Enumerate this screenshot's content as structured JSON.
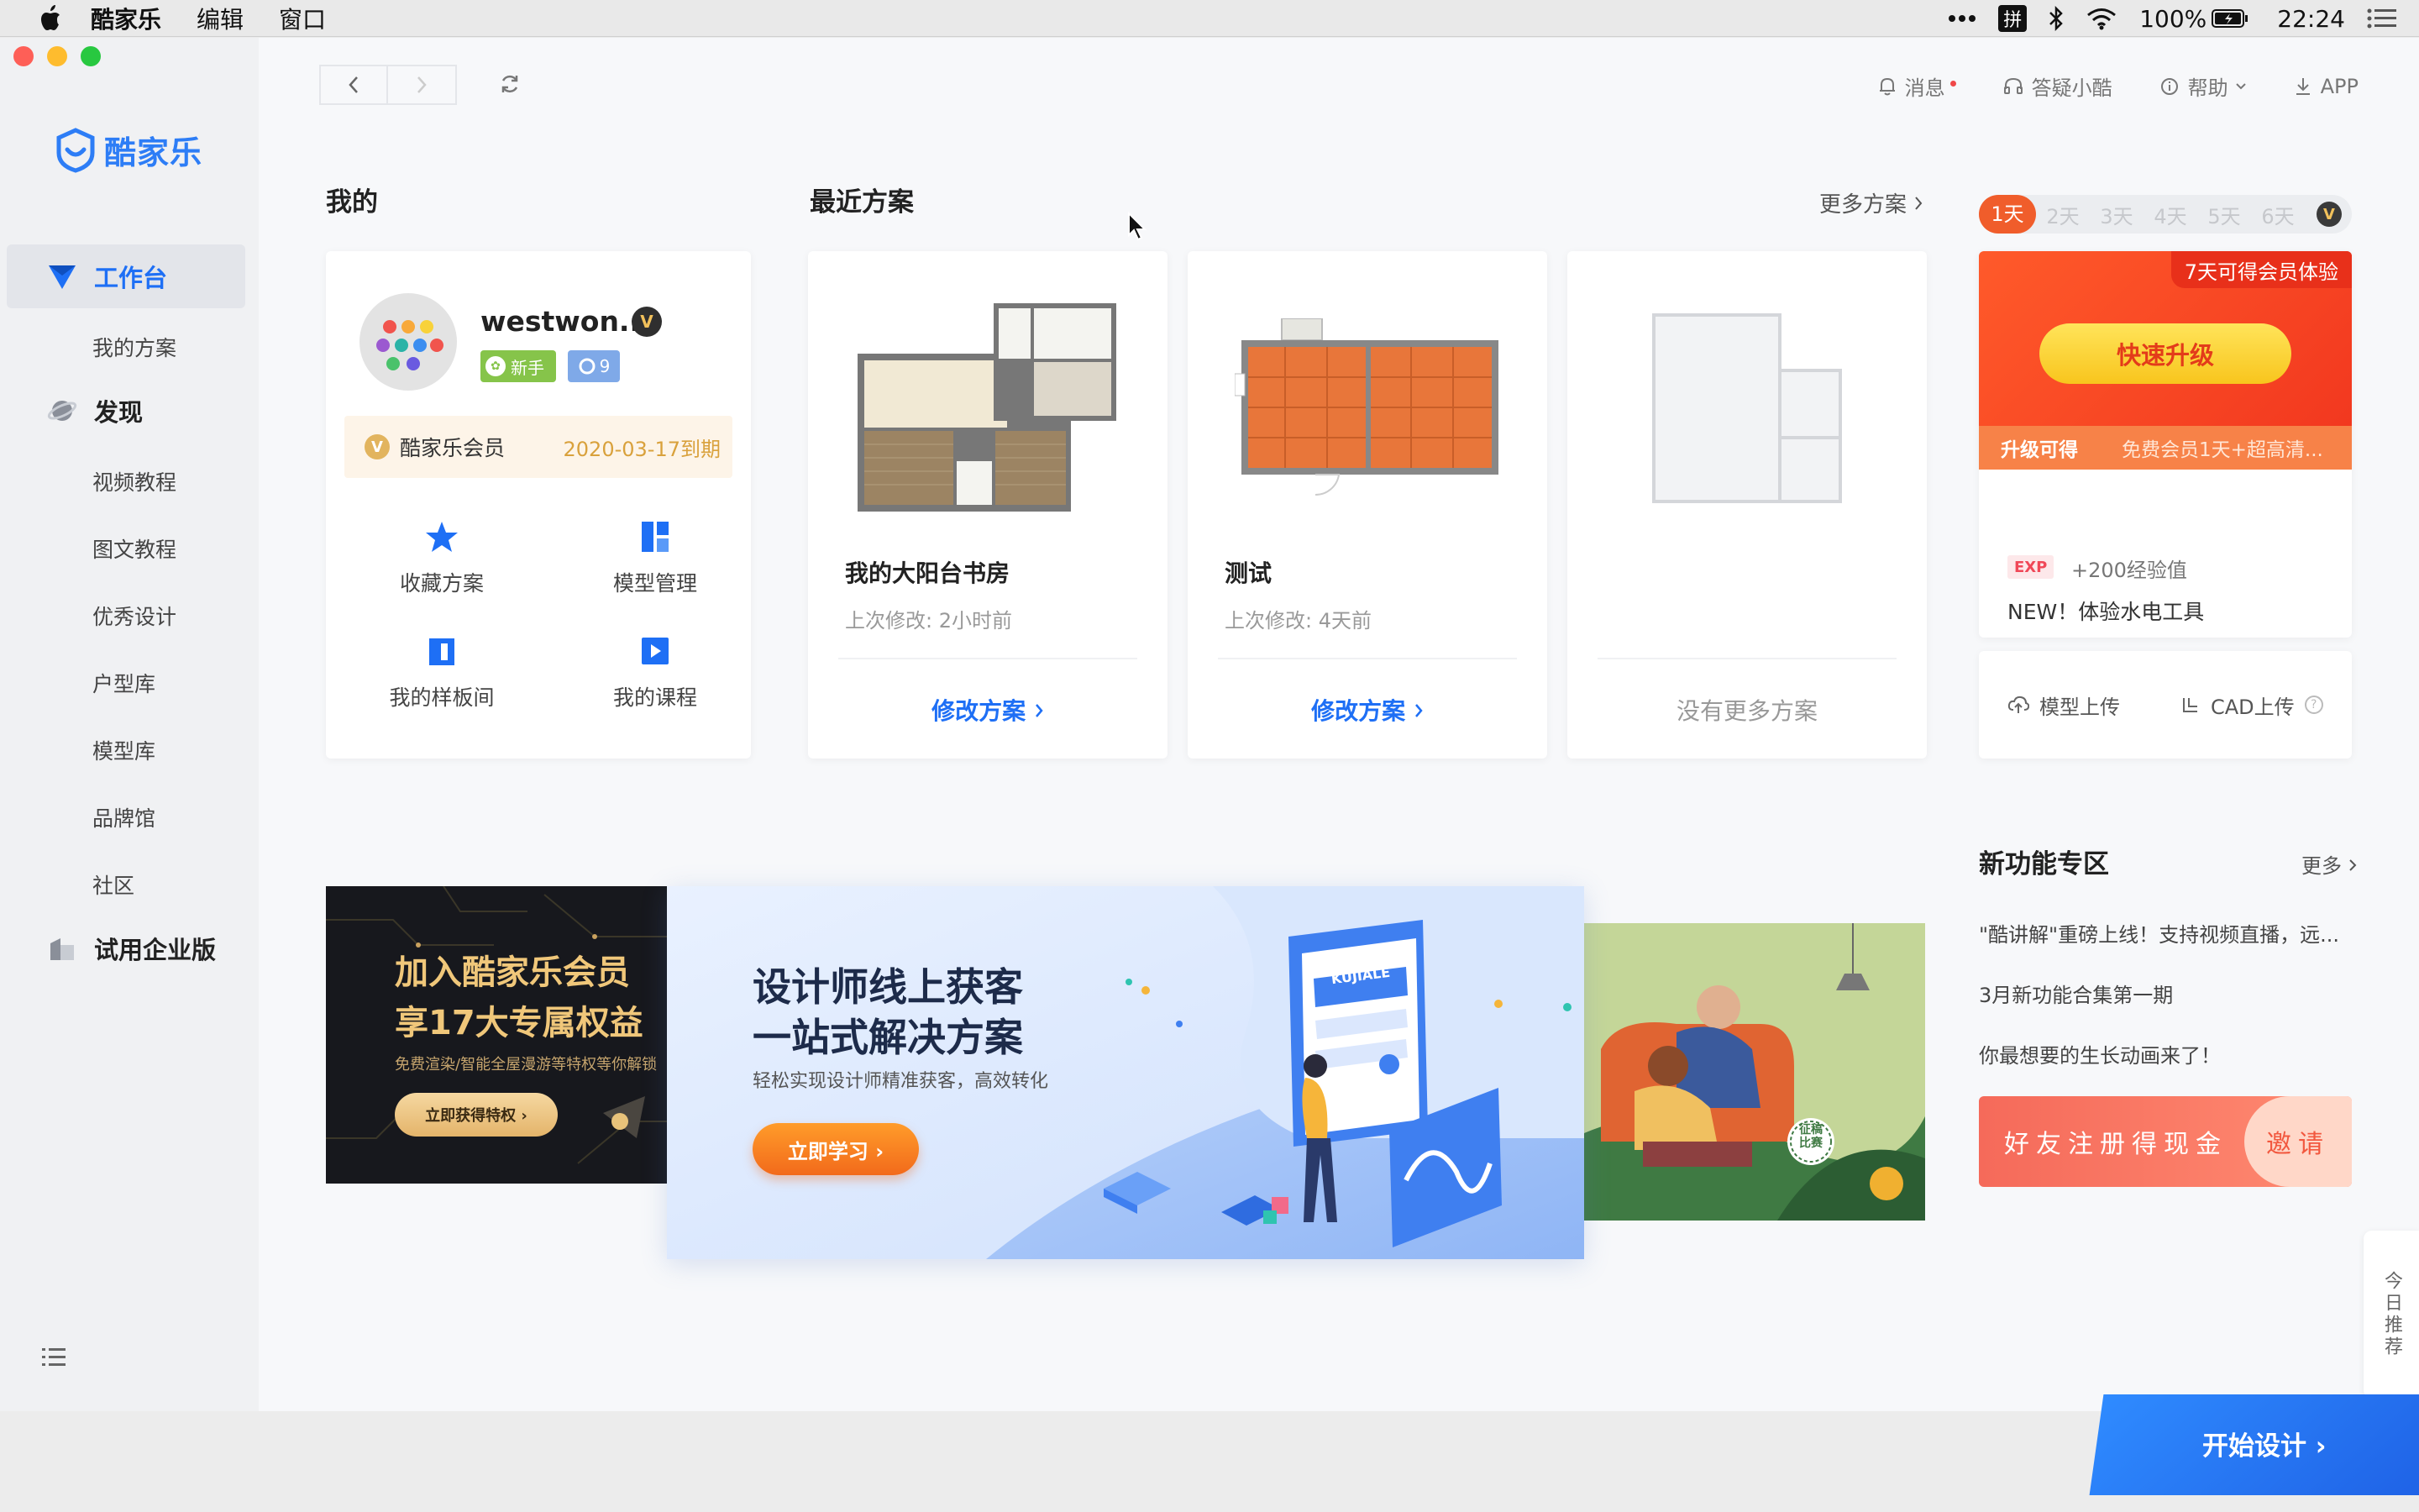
{
  "menubar": {
    "app_name": "酷家乐",
    "menus": [
      "编辑",
      "窗口"
    ],
    "battery": "100%",
    "time": "22:24",
    "ime_label": "拼"
  },
  "topbar": {
    "messages": "消息",
    "qa": "答疑小酷",
    "help": "帮助",
    "app": "APP"
  },
  "sidebar": {
    "logo_text": "酷家乐",
    "workbench": "工作台",
    "my_plans": "我的方案",
    "discover": "发现",
    "discover_items": [
      "视频教程",
      "图文教程",
      "优秀设计",
      "户型库",
      "模型库",
      "品牌馆",
      "社区"
    ],
    "enterprise": "试用企业版"
  },
  "profile": {
    "section_title": "我的",
    "username": "westwon...",
    "tag_new": "新手",
    "level": "9",
    "member_name": "酷家乐会员",
    "member_expiry": "2020-03-17到期",
    "vip_letter": "V",
    "quick_actions": [
      "收藏方案",
      "模型管理",
      "我的样板间",
      "我的课程"
    ]
  },
  "recent": {
    "section_title": "最近方案",
    "more": "更多方案",
    "plans": [
      {
        "title": "我的大阳台书房",
        "modified": "上次修改: 2小时前",
        "action": "修改方案"
      },
      {
        "title": "测试",
        "modified": "上次修改: 4天前",
        "action": "修改方案"
      }
    ],
    "no_more": "没有更多方案"
  },
  "member_promo": {
    "days": [
      "1天",
      "2天",
      "3天",
      "4天",
      "5天",
      "6天"
    ],
    "corner": "7天可得会员体验",
    "upgrade_button": "快速升级",
    "strip_left": "升级可得",
    "strip_right": "免费会员1天+超高清...",
    "exp_tag": "EXP",
    "exp_text": "+200经验值",
    "new_tool": "NEW！体验水电工具"
  },
  "upload": {
    "model": "模型上传",
    "cad": "CAD上传"
  },
  "banners": {
    "left_title1": "加入酷家乐会员",
    "left_title2": "享17大专属权益",
    "left_sub": "免费渲染/智能全屋漫游等特权等你解锁",
    "left_button": "立即获得特权 ›",
    "center_title1": "设计师线上获客",
    "center_title2": "一站式解决方案",
    "center_sub": "轻松实现设计师精准获客，高效转化",
    "center_button": "立即学习 ›",
    "center_card_brand": "KUJIALE",
    "right_stamp": "征稿比赛"
  },
  "new_features": {
    "title": "新功能专区",
    "more": "更多",
    "items": [
      "\"酷讲解\"重磅上线！支持视频直播，远...",
      "3月新功能合集第一期",
      "你最想要的生长动画来了！"
    ]
  },
  "invite": {
    "left": "好友注册得现金",
    "right": "邀请"
  },
  "side_tab": "今日推荐",
  "start_design": "开始设计 ›",
  "colors": {
    "accent": "#1e6ff5",
    "promo_red": "#f2381f",
    "gold": "#d9a13c"
  }
}
